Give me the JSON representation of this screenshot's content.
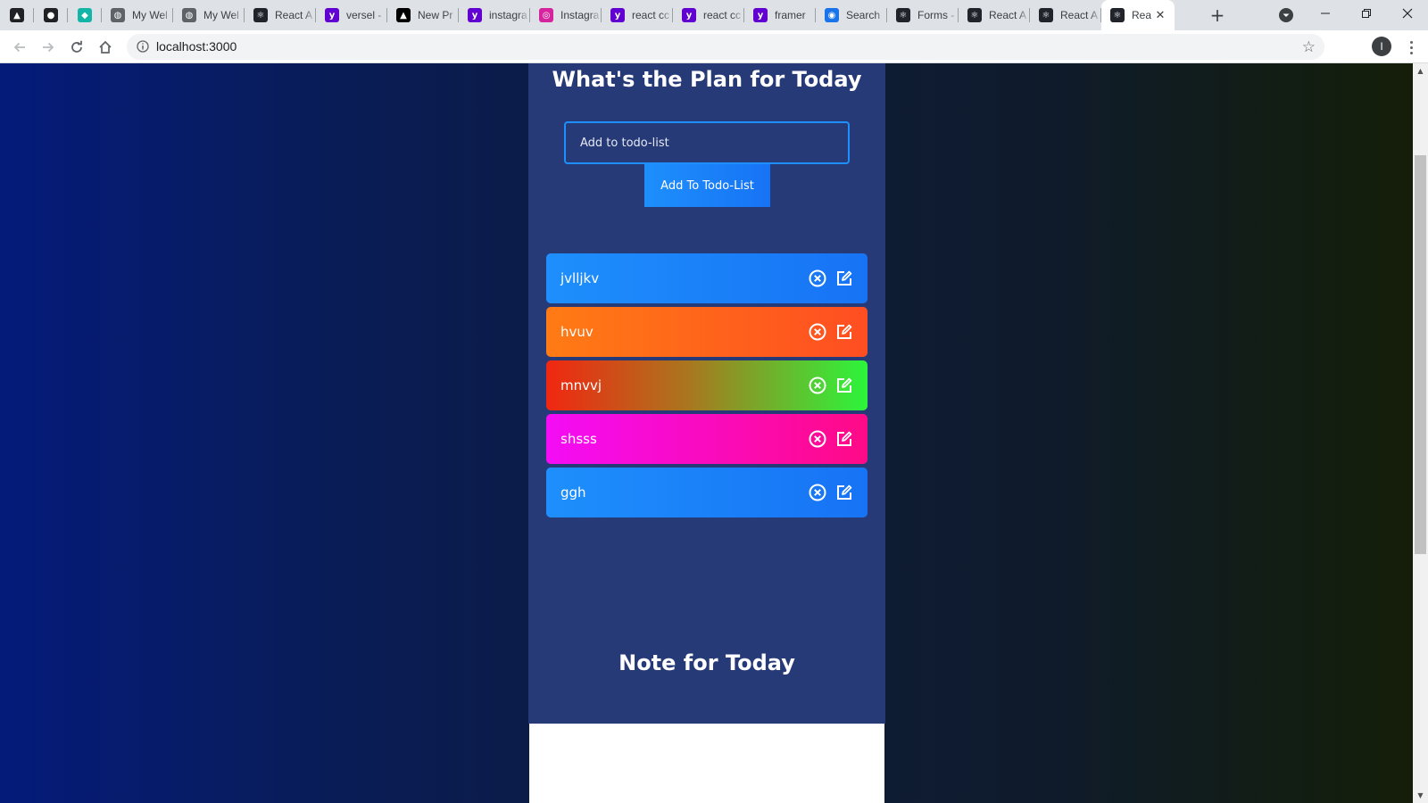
{
  "browser": {
    "tabs": [
      {
        "label": "",
        "icon": "app-icon",
        "pinned": true,
        "icon_bg": "#202124"
      },
      {
        "label": "",
        "icon": "github-icon",
        "pinned": true,
        "icon_bg": "#202124"
      },
      {
        "label": "",
        "icon": "diamond-icon",
        "pinned": true,
        "icon_bg": "#13b5a6"
      },
      {
        "label": "My Wel",
        "icon": "globe-icon",
        "icon_bg": "#5f6368"
      },
      {
        "label": "My Wel",
        "icon": "globe-icon",
        "icon_bg": "#5f6368"
      },
      {
        "label": "React A",
        "icon": "react-icon",
        "icon_bg": "#20232a"
      },
      {
        "label": "versel -",
        "icon": "yahoo-icon",
        "icon_bg": "#6001d2"
      },
      {
        "label": "New Pr",
        "icon": "vercel-icon",
        "icon_bg": "#000000"
      },
      {
        "label": "instagra",
        "icon": "yahoo-icon",
        "icon_bg": "#6001d2"
      },
      {
        "label": "Instagra",
        "icon": "instagram-icon",
        "icon_bg": "#d6249f"
      },
      {
        "label": "react cc",
        "icon": "yahoo-icon",
        "icon_bg": "#6001d2"
      },
      {
        "label": "react cc",
        "icon": "yahoo-icon",
        "icon_bg": "#6001d2"
      },
      {
        "label": "framer",
        "icon": "yahoo-icon",
        "icon_bg": "#6001d2"
      },
      {
        "label": "Search",
        "icon": "search-engine-icon",
        "icon_bg": "#1a73e8"
      },
      {
        "label": "Forms -",
        "icon": "react-icon",
        "icon_bg": "#20232a"
      },
      {
        "label": "React A",
        "icon": "react-icon",
        "icon_bg": "#20232a"
      },
      {
        "label": "React A",
        "icon": "react-icon",
        "icon_bg": "#20232a"
      },
      {
        "label": "Rea",
        "icon": "react-icon",
        "icon_bg": "#20232a",
        "active": true
      }
    ],
    "url": "localhost:3000",
    "profile_initial": "I"
  },
  "app": {
    "title": "What's the Plan for Today",
    "input_placeholder": "Add to todo-list",
    "add_button_label": "Add To Todo-List",
    "note_title": "Note for Today"
  },
  "todos": [
    {
      "text": "jvlljkv",
      "gradient": "linear-gradient(90deg, #1e8ffc 0%, #1773f5 100%)"
    },
    {
      "text": "hvuv",
      "gradient": "linear-gradient(90deg, #ff7b14 0%, #ff4e22 100%)"
    },
    {
      "text": "mnvvj",
      "gradient": "linear-gradient(90deg, #f12711 0%, #a8781f 45%, #2cf53b 100%)"
    },
    {
      "text": "shsss",
      "gradient": "linear-gradient(90deg, #f40cf6 0%, #ff0a86 100%)"
    },
    {
      "text": "ggh",
      "gradient": "linear-gradient(90deg, #1e8ffc 0%, #1773f5 100%)"
    }
  ]
}
